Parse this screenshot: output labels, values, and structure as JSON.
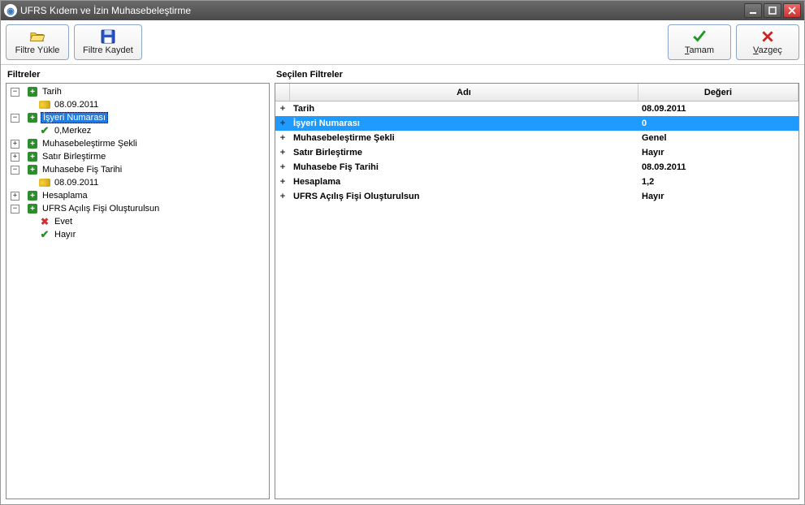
{
  "window": {
    "title": "UFRS Kıdem ve İzin Muhasebeleştirme"
  },
  "toolbar": {
    "load_label": "Filtre Yükle",
    "save_label": "Filtre Kaydet",
    "ok_prefix": "T",
    "ok_label": "amam",
    "cancel_prefix": "V",
    "cancel_label": "azgeç"
  },
  "left": {
    "heading": "Filtreler"
  },
  "tree": {
    "n0": "Tarih",
    "n0_0": "08.09.2011",
    "n1": "İşyeri Numarası",
    "n1_0": "0,Merkez",
    "n2": "Muhasebeleştirme Şekli",
    "n3": "Satır Birleştirme",
    "n4": "Muhasebe Fiş Tarihi",
    "n4_0": "08.09.2011",
    "n5": "Hesaplama",
    "n6": "UFRS Açılış Fişi Oluşturulsun",
    "n6_0": "Evet",
    "n6_1": "Hayır"
  },
  "right": {
    "heading": "Seçilen Filtreler",
    "col_name": "Adı",
    "col_value": "Değeri"
  },
  "grid": [
    {
      "name": "Tarih",
      "value": "08.09.2011",
      "selected": false
    },
    {
      "name": "İşyeri Numarası",
      "value": "0",
      "selected": true
    },
    {
      "name": "Muhasebeleştirme Şekli",
      "value": "Genel",
      "selected": false
    },
    {
      "name": "Satır Birleştirme",
      "value": "Hayır",
      "selected": false
    },
    {
      "name": "Muhasebe Fiş Tarihi",
      "value": "08.09.2011",
      "selected": false
    },
    {
      "name": "Hesaplama",
      "value": "1,2",
      "selected": false
    },
    {
      "name": "UFRS Açılış Fişi Oluşturulsun",
      "value": "Hayır",
      "selected": false
    }
  ]
}
